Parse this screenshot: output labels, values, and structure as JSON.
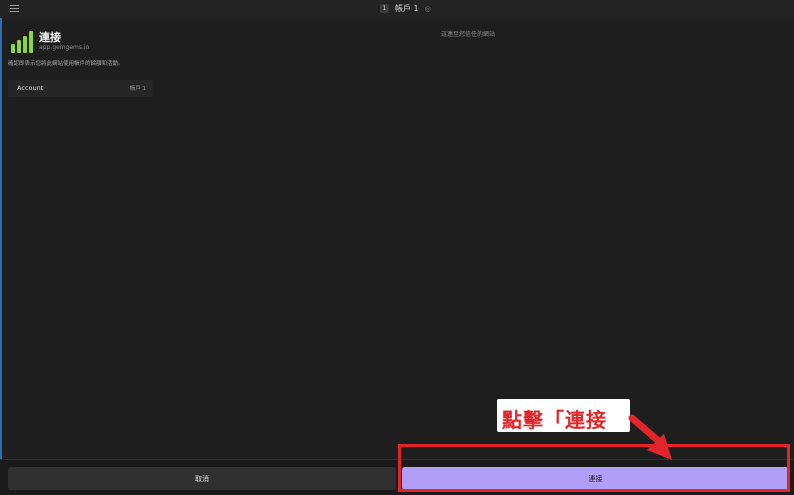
{
  "header": {
    "account_badge": "1",
    "account_name": "帳戶 1",
    "chevron": "◎"
  },
  "app": {
    "title": "連接",
    "url": "app.gemgems.io",
    "description": "確認即表示您將此網站使用帳戶的餘額和活動。",
    "right_note": "這連至您信任的網站"
  },
  "account_row": {
    "label": "Account",
    "value": "帳戶 1"
  },
  "buttons": {
    "cancel": "取消",
    "connect": "連接"
  },
  "annotation": {
    "callout": "點擊「連接",
    "color": "#e1252a"
  },
  "colors": {
    "accent": "#b19ff7",
    "logo": "#8bd53e",
    "background": "#1e1e1f"
  },
  "icons": [
    "menu-icon",
    "app-logo-icon",
    "chevron-icon"
  ]
}
